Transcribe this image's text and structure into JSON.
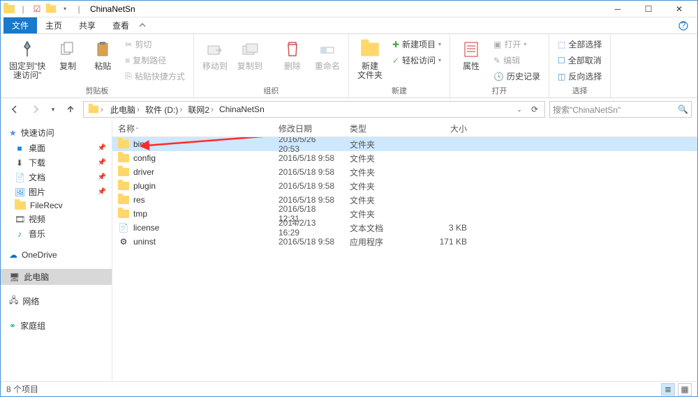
{
  "window": {
    "title": "ChinaNetSn"
  },
  "tabs": {
    "file": "文件",
    "home": "主页",
    "share": "共享",
    "view": "查看"
  },
  "ribbon": {
    "pin": "固定到\"快\n速访问\"",
    "copy": "复制",
    "paste": "粘贴",
    "cut": "剪切",
    "copypath": "复制路径",
    "pastelink": "粘贴快捷方式",
    "group_clipboard": "剪贴板",
    "moveto": "移动到",
    "copyto": "复制到",
    "delete": "删除",
    "rename": "重命名",
    "group_org": "组织",
    "newfolder": "新建\n文件夹",
    "newitem": "新建项目",
    "easyaccess": "轻松访问",
    "group_new": "新建",
    "properties": "属性",
    "open": "打开",
    "edit": "编辑",
    "history": "历史记录",
    "group_open": "打开",
    "selectall": "全部选择",
    "selectnone": "全部取消",
    "invert": "反向选择",
    "group_select": "选择"
  },
  "breadcrumb": {
    "items": [
      "此电脑",
      "软件 (D:)",
      "联网2",
      "ChinaNetSn"
    ]
  },
  "search": {
    "placeholder": "搜索\"ChinaNetSn\""
  },
  "tree": {
    "quickaccess": "快速访问",
    "items": [
      {
        "icon": "desktop",
        "label": "桌面",
        "pin": true,
        "color": "#1e88e5"
      },
      {
        "icon": "download",
        "label": "下载",
        "pin": true,
        "color": "#555"
      },
      {
        "icon": "doc",
        "label": "文档",
        "pin": true,
        "color": "#555"
      },
      {
        "icon": "pic",
        "label": "图片",
        "pin": true,
        "color": "#1e88e5"
      },
      {
        "icon": "folder",
        "label": "FileRecv",
        "pin": false,
        "color": "#fc0"
      },
      {
        "icon": "video",
        "label": "视频",
        "pin": false,
        "color": "#555"
      },
      {
        "icon": "music",
        "label": "音乐",
        "pin": false,
        "color": "#1e88e5"
      }
    ],
    "onedrive": "OneDrive",
    "thispc": "此电脑",
    "network": "网络",
    "homegroup": "家庭组"
  },
  "filelist": {
    "columns": {
      "name": "名称",
      "date": "修改日期",
      "type": "类型",
      "size": "大小"
    },
    "rows": [
      {
        "icon": "folder",
        "name": "bin",
        "date": "2016/5/26 20:53",
        "type": "文件夹",
        "size": "",
        "selected": true
      },
      {
        "icon": "folder",
        "name": "config",
        "date": "2016/5/18 9:58",
        "type": "文件夹",
        "size": ""
      },
      {
        "icon": "folder",
        "name": "driver",
        "date": "2016/5/18 9:58",
        "type": "文件夹",
        "size": ""
      },
      {
        "icon": "folder",
        "name": "plugin",
        "date": "2016/5/18 9:58",
        "type": "文件夹",
        "size": ""
      },
      {
        "icon": "folder",
        "name": "res",
        "date": "2016/5/18 9:58",
        "type": "文件夹",
        "size": ""
      },
      {
        "icon": "folder",
        "name": "tmp",
        "date": "2016/5/18 12:31",
        "type": "文件夹",
        "size": ""
      },
      {
        "icon": "text",
        "name": "license",
        "date": "2014/2/13 16:29",
        "type": "文本文档",
        "size": "3 KB"
      },
      {
        "icon": "exe",
        "name": "uninst",
        "date": "2016/5/18 9:58",
        "type": "应用程序",
        "size": "171 KB"
      }
    ]
  },
  "status": {
    "text": "8 个项目"
  }
}
